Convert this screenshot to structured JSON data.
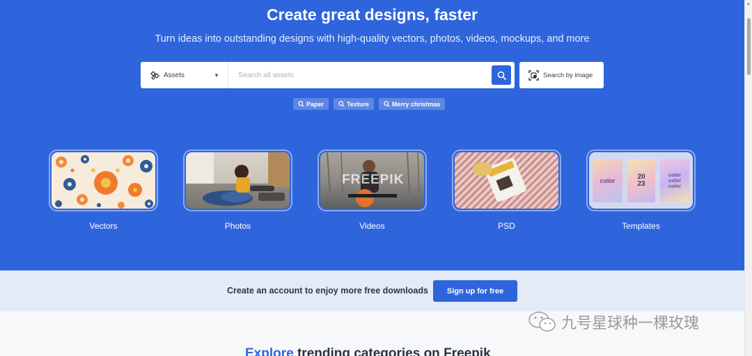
{
  "hero": {
    "title": "Create great designs, faster",
    "subtitle": "Turn ideas into outstanding designs with high-quality vectors, photos, videos, mockups, and more"
  },
  "search": {
    "asset_label": "Assets",
    "asset_icon": "assets-icon",
    "placeholder": "Search all assets",
    "value": "",
    "search_icon": "search-icon",
    "image_search_label": "Search by image",
    "image_search_icon": "image-search-icon"
  },
  "tags": [
    "Paper",
    "Texture",
    "Merry christmas"
  ],
  "categories": [
    {
      "label": "Vectors"
    },
    {
      "label": "Photos"
    },
    {
      "label": "Videos",
      "overlay_text": "FREEPIK"
    },
    {
      "label": "PSD"
    },
    {
      "label": "Templates",
      "card_texts": [
        "color",
        "20 23",
        "color color color"
      ]
    }
  ],
  "signup": {
    "text": "Create an account to enjoy more free downloads",
    "button": "Sign up for free"
  },
  "explore": {
    "accent": "Explore",
    "rest": " trending categories on Freepik"
  },
  "watermark": {
    "text": "九号星球种一棵玫瑰"
  },
  "colors": {
    "brand_blue": "#2f65dc",
    "band_bg": "#e3ebf8",
    "tag_bg": "#5f86e4"
  }
}
